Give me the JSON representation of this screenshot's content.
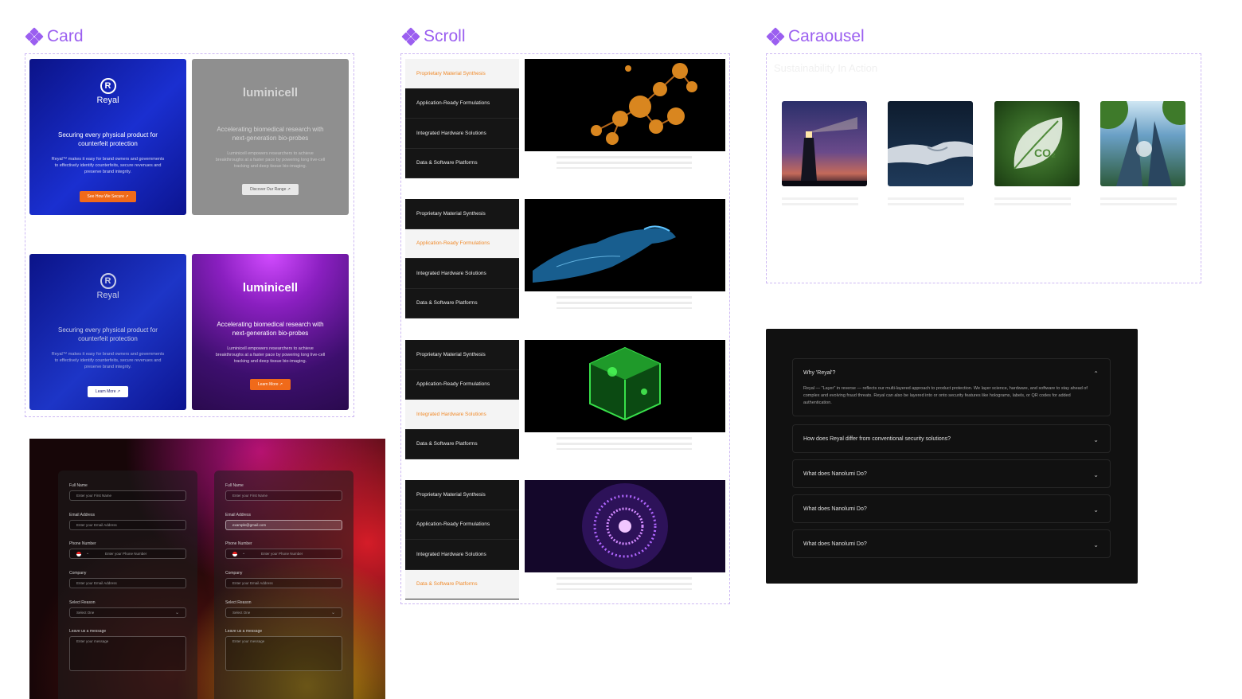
{
  "sections": {
    "card": "Card",
    "scroll": "Scroll",
    "carousel": "Caraousel"
  },
  "cards": {
    "reyal_active": {
      "brand": "Reyal",
      "headline": "Securing every physical product for counterfeit protection",
      "body": "Reyal™ makes it easy for brand owners and governments to effectively identify counterfeits, secure revenues and preserve brand integrity.",
      "button": "See How We Secure ↗"
    },
    "lumi_inactive": {
      "brand": "luminicell",
      "headline": "Accelerating biomedical research with next-generation bio-probes",
      "body": "Luminicell empowers researchers to achieve breakthroughs at a faster pace by powering long live-cell tracking and deep tissue bio-imaging.",
      "button": "Discover Our Range ↗"
    },
    "reyal_inactive": {
      "brand": "Reyal",
      "headline": "Securing every physical product for counterfeit protection",
      "body": "Reyal™ makes it easy for brand owners and governments to effectively identify counterfeits, secure revenues and preserve brand integrity.",
      "button": "Learn More ↗"
    },
    "lumi_active": {
      "brand": "luminicell",
      "headline": "Accelerating biomedical research with next-generation bio-probes",
      "body": "Luminicell empowers researchers to achieve breakthroughs at a faster pace by powering long live-cell tracking and deep tissue bio-imaging.",
      "button": "Learn More ↗"
    }
  },
  "scroll": {
    "items": [
      "Proprietary Material Synthesis",
      "Application-Ready Formulations",
      "Integrated Hardware Solutions",
      "Data & Software Platforms"
    ]
  },
  "carousel": {
    "heading": "Sustainability In Action"
  },
  "faq": {
    "items": [
      {
        "q": "Why 'Reyal'?",
        "a": "Reyal — \"Layer\" in reverse — reflects our multi-layered approach to product protection. We layer science, hardware, and software to stay ahead of complex and evolving fraud threats. Reyal can also be layered into or onto security features like holograms, labels, or QR codes for added authentication."
      },
      {
        "q": "How does Reyal differ from conventional security solutions?"
      },
      {
        "q": "What does Nanolumi Do?"
      },
      {
        "q": "What does Nanolumi Do?"
      },
      {
        "q": "What does Nanolumi Do?"
      }
    ]
  },
  "form": {
    "full_name_label": "Full Name",
    "full_name_placeholder": "Enter your First Name",
    "email_label": "Email Address",
    "email_placeholder": "Enter your Email Address",
    "email_filled": "example@gmail.com",
    "phone_label": "Phone Number",
    "phone_placeholder": "Enter your Phone Number",
    "company_label": "Company",
    "company_placeholder": "Enter your Email Address",
    "reason_label": "Select Reason",
    "reason_value": "Select One",
    "message_label": "Leave us a message",
    "message_placeholder": "Enter your message"
  }
}
